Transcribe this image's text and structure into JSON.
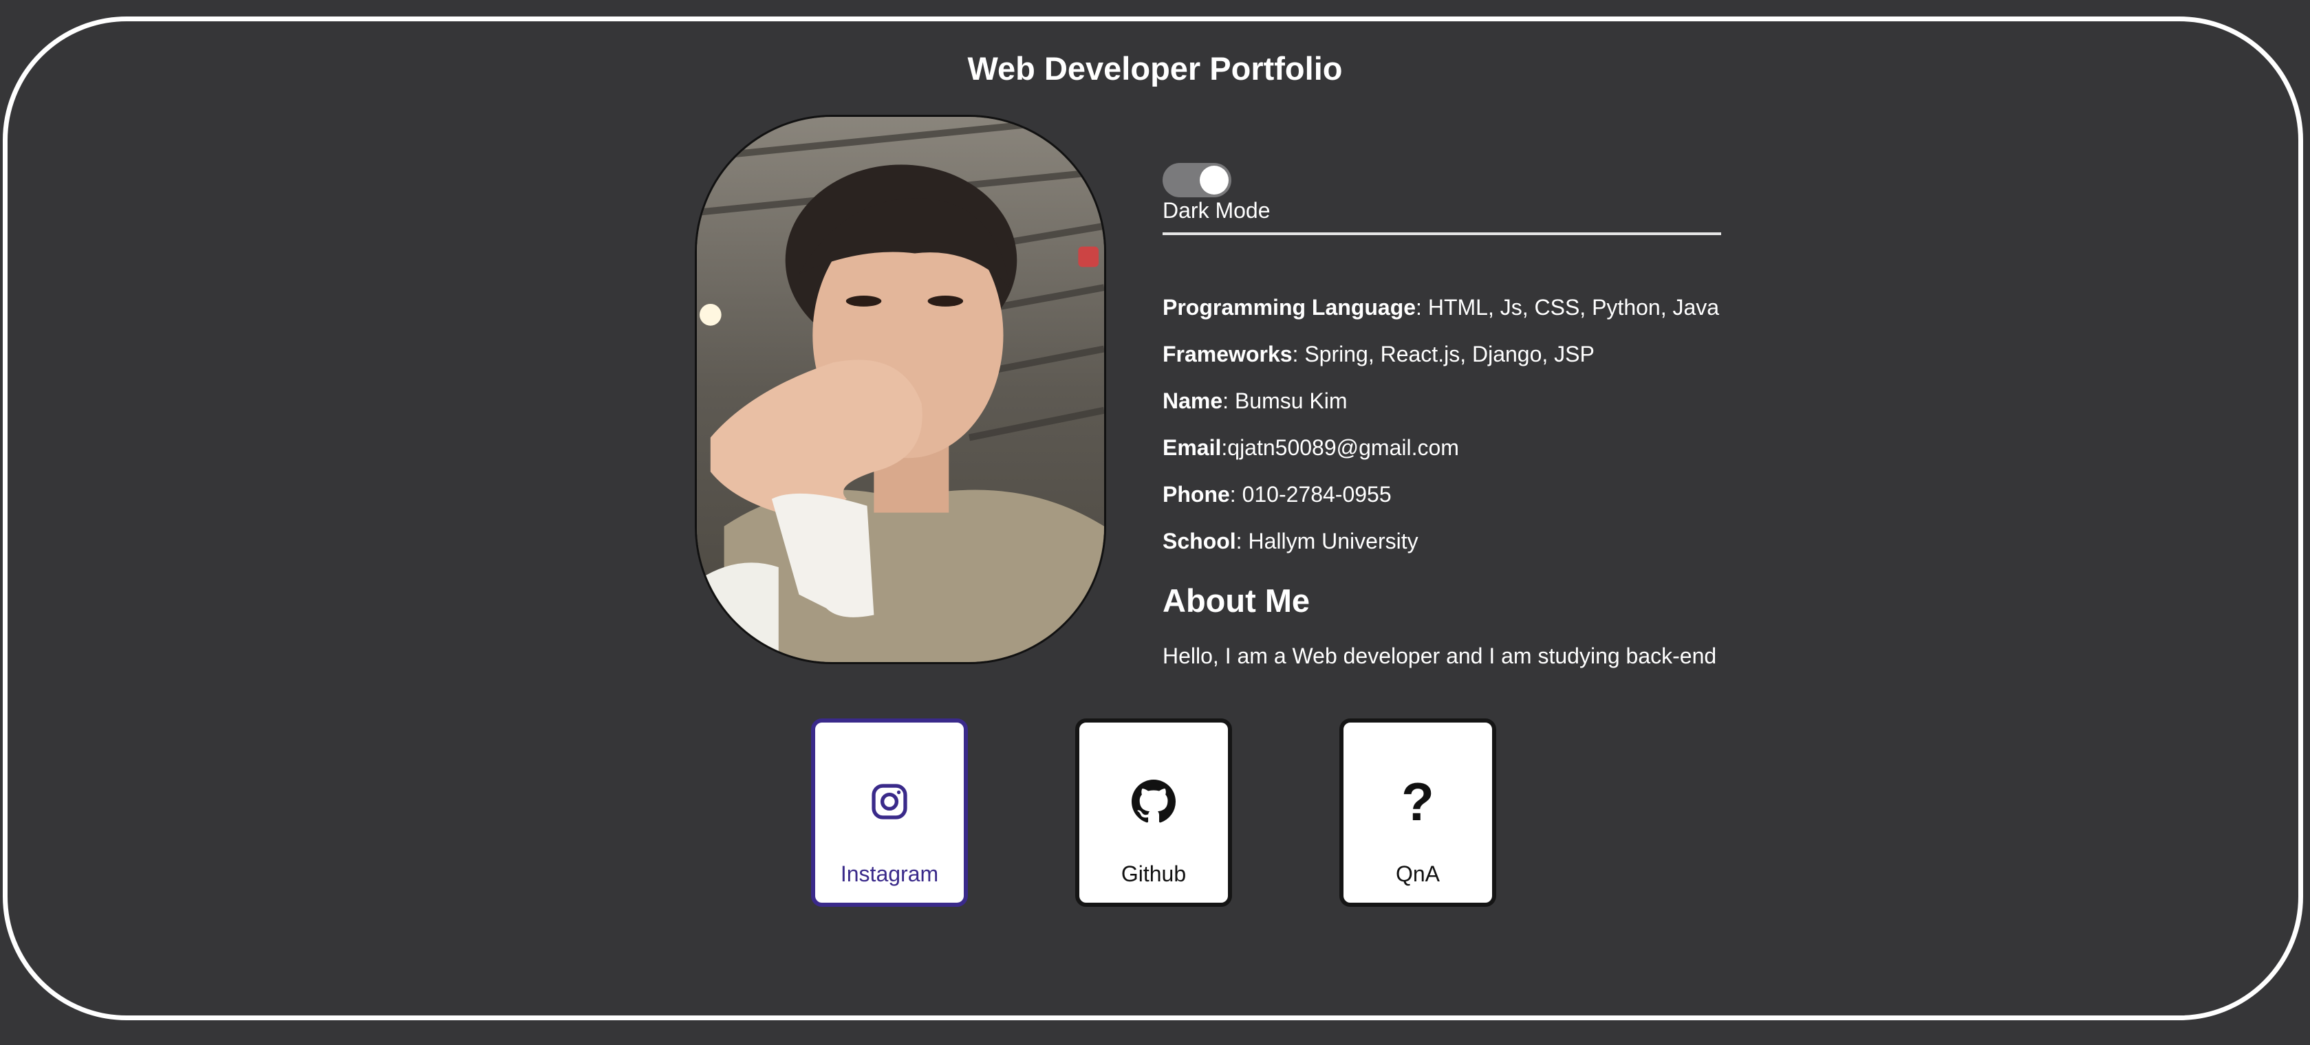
{
  "page": {
    "title": "Web Developer Portfolio"
  },
  "theme": {
    "background": "#363638",
    "frame": "#ffffff",
    "accent": "#3a2a8a"
  },
  "profile": {
    "photo_icon": "profile-photo"
  },
  "toggle": {
    "label": "Dark Mode",
    "state": "on"
  },
  "info": {
    "languages": {
      "label": "Programming Language",
      "value": ": HTML, Js, CSS, Python, Java"
    },
    "frameworks": {
      "label": "Frameworks",
      "value": ": Spring, React.js, Django, JSP"
    },
    "name": {
      "label": "Name",
      "value": ": Bumsu Kim"
    },
    "email": {
      "label": "Email",
      "value": ":qjatn50089@gmail.com"
    },
    "phone": {
      "label": "Phone",
      "value": ": 010-2784-0955"
    },
    "school": {
      "label": "School",
      "value": ": Hallym University"
    }
  },
  "about": {
    "title": "About Me",
    "text": "Hello, I am a Web developer and I am studying back-end"
  },
  "links": [
    {
      "label": "Instagram",
      "icon": "instagram-icon"
    },
    {
      "label": "Github",
      "icon": "github-icon"
    },
    {
      "label": "QnA",
      "icon": "question-icon",
      "glyph": "?"
    }
  ]
}
